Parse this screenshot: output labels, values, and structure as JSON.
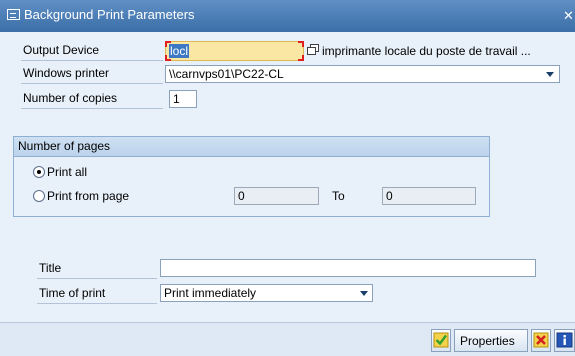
{
  "window": {
    "title": "Background Print Parameters"
  },
  "form": {
    "output_device": {
      "label": "Output Device",
      "value": "locl",
      "description": "imprimante locale du poste de travail ..."
    },
    "windows_printer": {
      "label": "Windows printer",
      "value": "\\\\carnvps01\\PC22-CL"
    },
    "copies": {
      "label": "Number of copies",
      "value": "1"
    }
  },
  "pages_group": {
    "title": "Number of pages",
    "print_all": {
      "label": "Print all",
      "selected": true
    },
    "print_from": {
      "label": "Print from page",
      "selected": false,
      "from_value": "0",
      "to_label": "To",
      "to_value": "0"
    }
  },
  "print_title": {
    "label": "Title",
    "value": ""
  },
  "time_of_print": {
    "label": "Time of print",
    "value": "Print immediately"
  },
  "toolbar": {
    "properties_label": "Properties"
  },
  "colors": {
    "title_bar": "#3c6ea8",
    "accept": "#2ea12e",
    "cancel": "#d42020",
    "info": "#2457b8"
  }
}
